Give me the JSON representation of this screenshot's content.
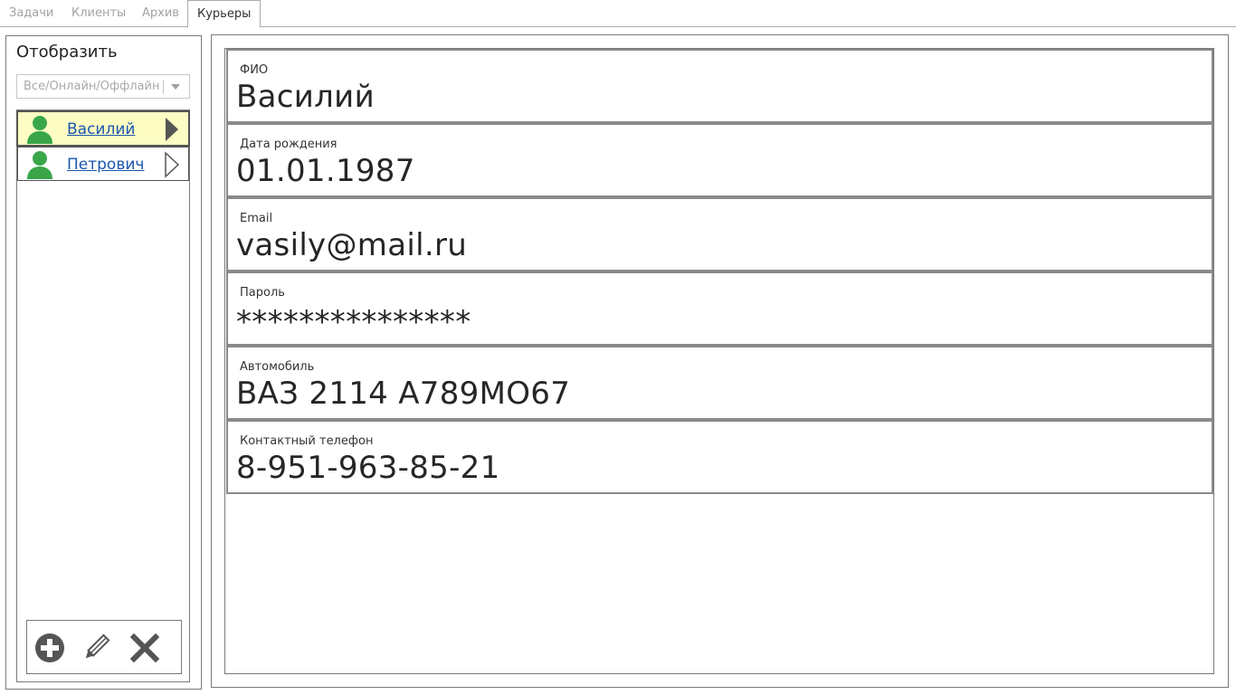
{
  "tabs": [
    {
      "label": "Задачи"
    },
    {
      "label": "Клиенты"
    },
    {
      "label": "Архив"
    },
    {
      "label": "Курьеры"
    }
  ],
  "sidebar": {
    "title": "Отобразить",
    "filter": {
      "selected": "Все/Онлайн/Оффлайн"
    },
    "couriers": [
      {
        "name": "Василий",
        "selected": true
      },
      {
        "name": "Петрович",
        "selected": false
      }
    ],
    "toolbar": {
      "add": "add-icon",
      "edit": "pencil-icon",
      "delete": "close-icon"
    }
  },
  "details": {
    "fields": [
      {
        "label": "ФИО",
        "value": "Василий"
      },
      {
        "label": "Дата рождения",
        "value": "01.01.1987"
      },
      {
        "label": "Email",
        "value": "vasily@mail.ru"
      },
      {
        "label": "Пароль",
        "value": "***************"
      },
      {
        "label": "Автомобиль",
        "value": "ВАЗ 2114 А789МО67"
      },
      {
        "label": "Контактный телефон",
        "value": "8-951-963-85-21"
      }
    ]
  },
  "colors": {
    "selected_row": "#fdfdc3",
    "avatar_green": "#3aa64a",
    "link_blue": "#1a56b0"
  }
}
